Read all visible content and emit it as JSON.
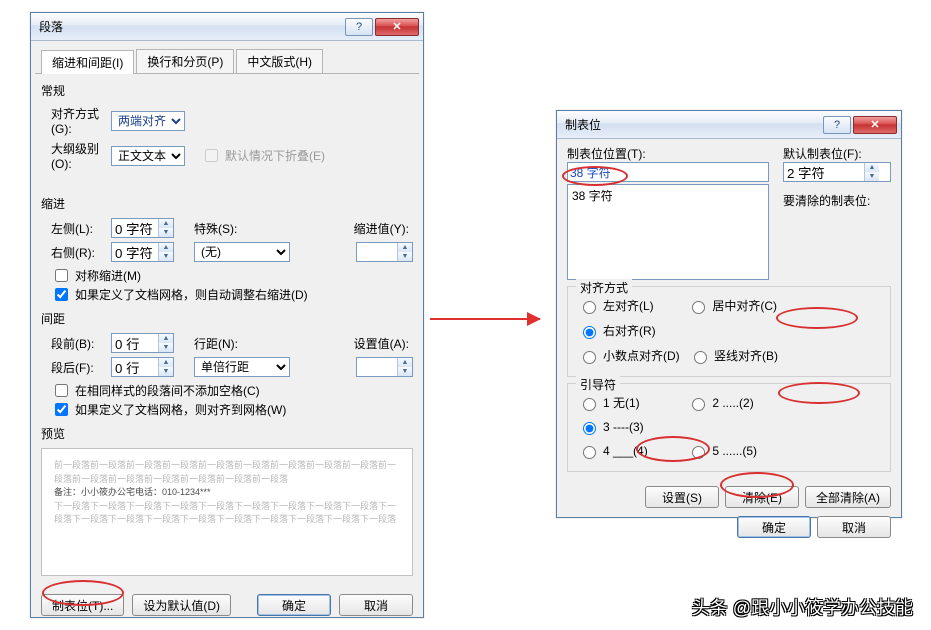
{
  "watermark": "头条 @跟小小筱学办公技能",
  "paragraph_dialog": {
    "title": "段落",
    "tabs": [
      "缩进和间距(I)",
      "换行和分页(P)",
      "中文版式(H)"
    ],
    "general_label": "常规",
    "alignment_label": "对齐方式(G):",
    "alignment_value": "两端对齐",
    "outline_label": "大纲级别(O):",
    "outline_value": "正文文本",
    "collapsed_label": "默认情况下折叠(E)",
    "indent_label": "缩进",
    "left_label": "左侧(L):",
    "left_value": "0 字符",
    "right_label": "右侧(R):",
    "right_value": "0 字符",
    "special_label": "特殊(S):",
    "special_value": "(无)",
    "by_label": "缩进值(Y):",
    "mirror_label": "对称缩进(M)",
    "autogrid_label": "如果定义了文档网格，则自动调整右缩进(D)",
    "spacing_label": "间距",
    "before_label": "段前(B):",
    "before_value": "0 行",
    "after_label": "段后(F):",
    "after_value": "0 行",
    "line_label": "行距(N):",
    "line_value": "单倍行距",
    "at_label": "设置值(A):",
    "noadd_label": "在相同样式的段落间不添加空格(C)",
    "snapgrid_label": "如果定义了文档网格，则对齐到网格(W)",
    "preview_label": "预览",
    "preview_light1": "前一段落前一段落前一段落前一段落前一段落前一段落前一段落前一段落前一段落前一段落前一段落前一段落前一段落前一段落前一段落前一段落",
    "preview_dark": "备注：小小筱办公宅电话：010-1234***",
    "preview_light2": "下一段落下一段落下一段落下一段落下一段落下一段落下一段落下一段落下一段落下一段落下一段落下一段落下一段落下一段落下一段落下一段落下一段落下一段落下一段落",
    "tabs_btn": "制表位(T)...",
    "default_btn": "设为默认值(D)",
    "ok_btn": "确定",
    "cancel_btn": "取消"
  },
  "tab_dialog": {
    "title": "制表位",
    "pos_label": "制表位位置(T):",
    "pos_value": "38 字符",
    "list_item": "38 字符",
    "default_label": "默认制表位(F):",
    "default_value": "2 字符",
    "clear_label": "要清除的制表位:",
    "align_legend": "对齐方式",
    "align_left": "左对齐(L)",
    "align_center": "居中对齐(C)",
    "align_right": "右对齐(R)",
    "align_decimal": "小数点对齐(D)",
    "align_bar": "竖线对齐(B)",
    "leader_legend": "引导符",
    "leader1": "1 无(1)",
    "leader2": "2 .....(2)",
    "leader3": "3 ----(3)",
    "leader4": "4 ___(4)",
    "leader5": "5 ......(5)",
    "set_btn": "设置(S)",
    "clear_btn": "清除(E)",
    "clearall_btn": "全部清除(A)",
    "ok_btn": "确定",
    "cancel_btn": "取消"
  }
}
